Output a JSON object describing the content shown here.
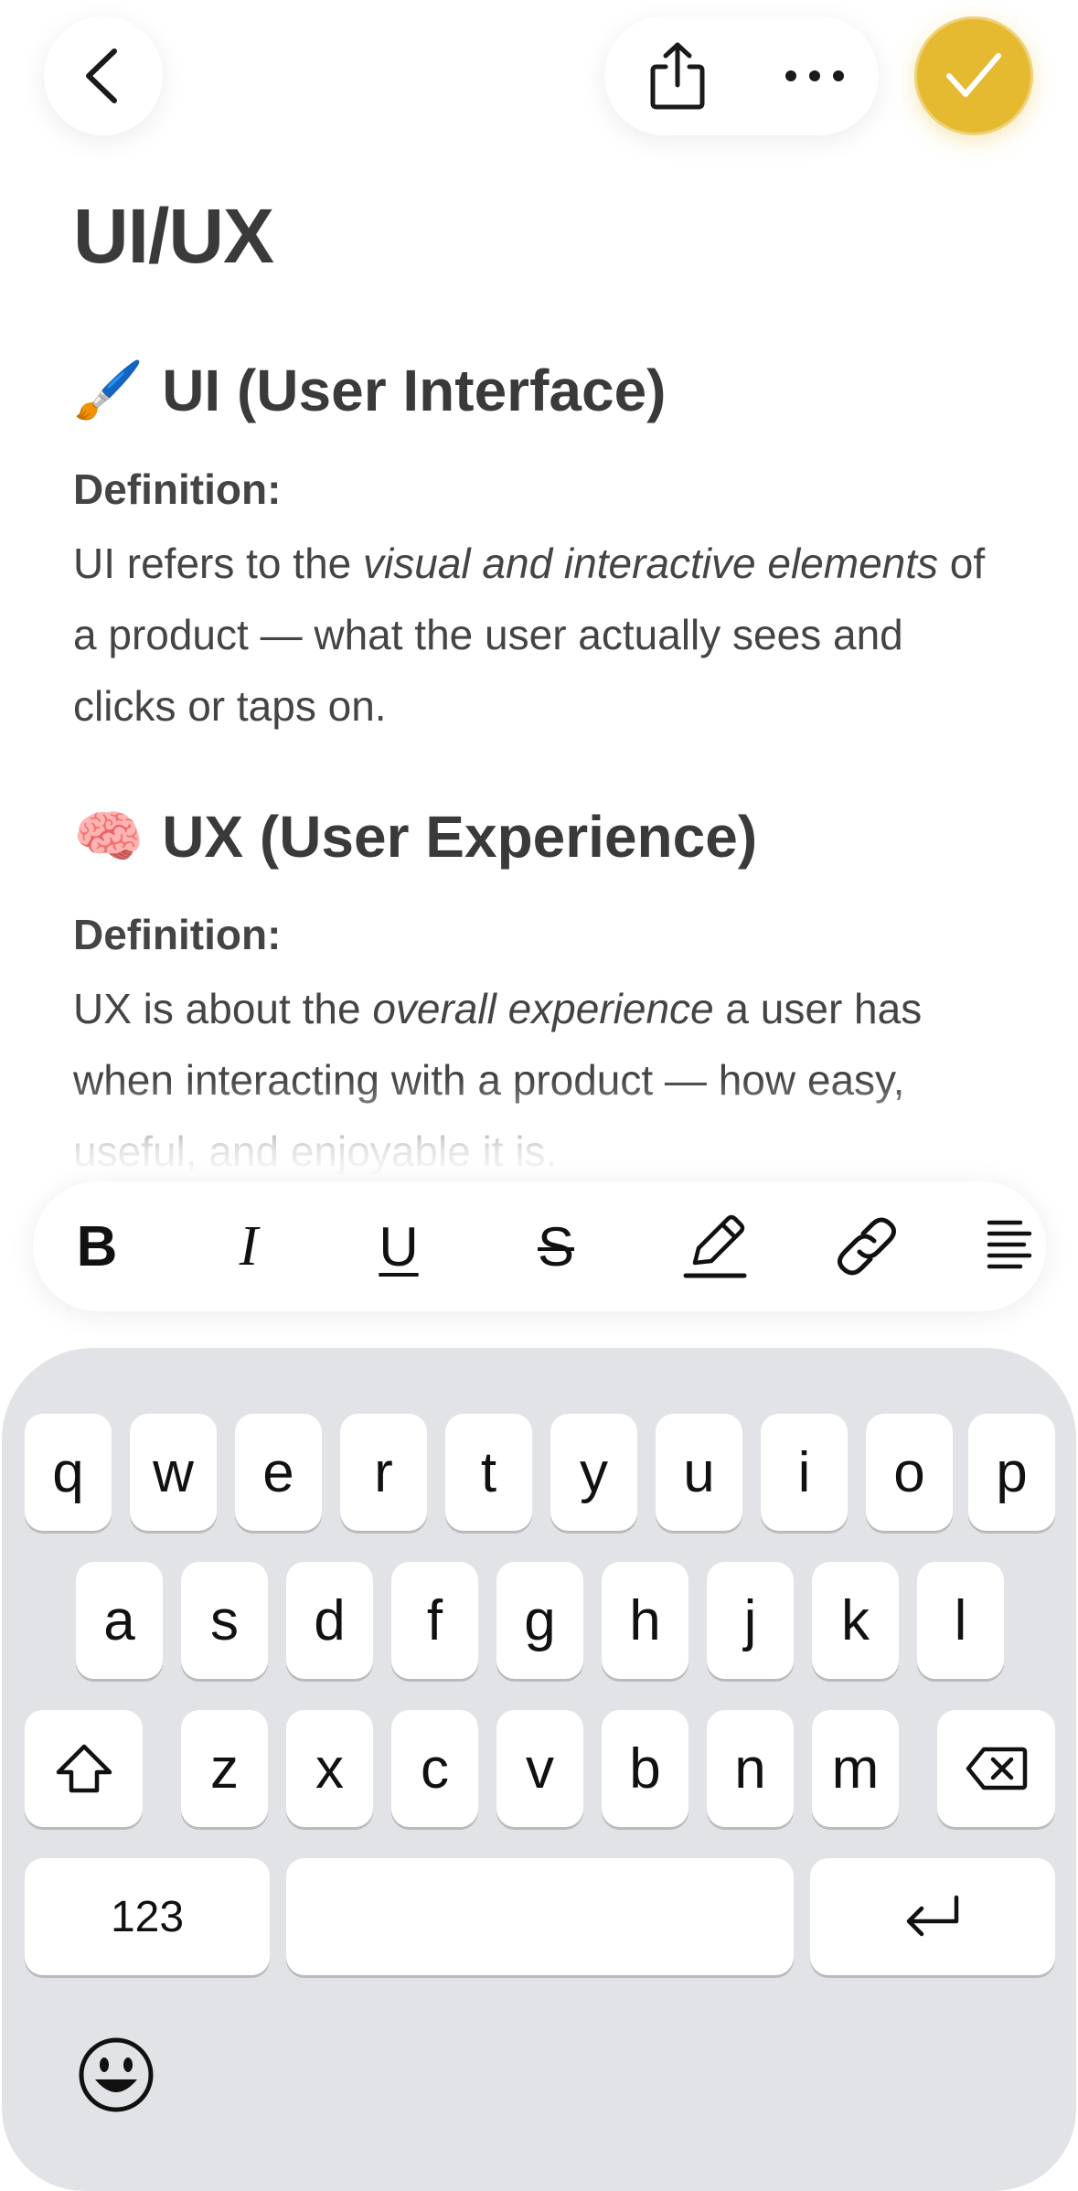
{
  "note": {
    "title": "UI/UX",
    "sections": [
      {
        "emoji": "🖌️",
        "heading": "UI (User Interface)",
        "definition_label": "Definition:",
        "definition_parts": [
          {
            "text": "UI refers to the ",
            "italic": false
          },
          {
            "text": "visual and interactive elements",
            "italic": true
          },
          {
            "text": " of a product — what the user actually sees and clicks or taps on.",
            "italic": false
          }
        ]
      },
      {
        "emoji": "🧠",
        "heading": "UX (User Experience)",
        "definition_label": "Definition:",
        "definition_parts": [
          {
            "text": "UX is about the ",
            "italic": false
          },
          {
            "text": "overall experience",
            "italic": true
          },
          {
            "text": " a user has when interacting with a product — how easy, useful, and enjoyable it is.",
            "italic": false
          }
        ]
      }
    ]
  },
  "toolbar": {
    "bold": "B",
    "italic": "I",
    "underline": "U",
    "strikethrough": "S",
    "icons": [
      "pencil-icon",
      "link-icon",
      "paragraph-align-icon"
    ]
  },
  "topbar": {
    "icons": [
      "chevron-left-icon",
      "share-icon",
      "more-icon",
      "checkmark-icon"
    ],
    "accent_color": "#e5b930"
  },
  "keyboard": {
    "row1": [
      "q",
      "w",
      "e",
      "r",
      "t",
      "y",
      "u",
      "i",
      "o",
      "p"
    ],
    "row2": [
      "a",
      "s",
      "d",
      "f",
      "g",
      "h",
      "j",
      "k",
      "l"
    ],
    "row3": [
      "z",
      "x",
      "c",
      "v",
      "b",
      "n",
      "m"
    ],
    "numbers_label": "123",
    "space_label": "",
    "icons": [
      "shift-icon",
      "delete-icon",
      "return-icon",
      "emoji-icon"
    ]
  }
}
